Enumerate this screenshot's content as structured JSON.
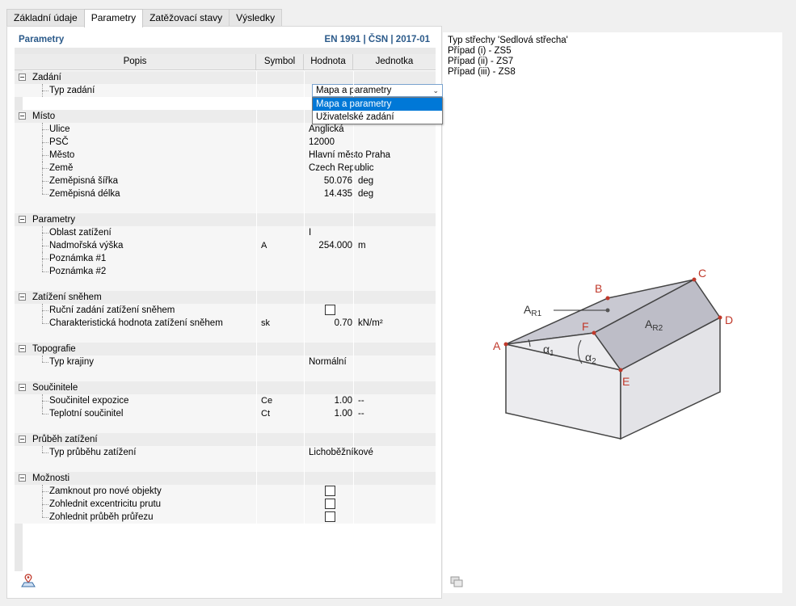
{
  "tabs": [
    {
      "label": "Základní údaje",
      "active": false
    },
    {
      "label": "Parametry",
      "active": true
    },
    {
      "label": "Zatěžovací stavy",
      "active": false
    },
    {
      "label": "Výsledky",
      "active": false
    }
  ],
  "panel": {
    "title": "Parametry",
    "standard": "EN 1991 | ČSN | 2017-01"
  },
  "columns": {
    "popis": "Popis",
    "symbol": "Symbol",
    "hodnota": "Hodnota",
    "jednotka": "Jednotka"
  },
  "groups": {
    "zadani": {
      "label": "Zadání",
      "typ_zadani": {
        "label": "Typ zadání",
        "value": "Mapa a parametry"
      }
    },
    "misto": {
      "label": "Místo",
      "items": [
        {
          "label": "Ulice",
          "value": "Anglická"
        },
        {
          "label": "PSČ",
          "value": "12000"
        },
        {
          "label": "Město",
          "value": "Hlavní město Praha"
        },
        {
          "label": "Země",
          "value": "Czech Republic"
        },
        {
          "label": "Zeměpisná šířka",
          "value": "50.076",
          "unit": "deg"
        },
        {
          "label": "Zeměpisná délka",
          "value": "14.435",
          "unit": "deg"
        }
      ]
    },
    "parametry": {
      "label": "Parametry",
      "items": [
        {
          "label": "Oblast zatížení",
          "value": "I"
        },
        {
          "label": "Nadmořská výška",
          "symbol": "A",
          "value": "254.000",
          "unit": "m"
        },
        {
          "label": "Poznámka #1"
        },
        {
          "label": "Poznámka #2"
        }
      ]
    },
    "snih": {
      "label": "Zatížení sněhem",
      "items": [
        {
          "label": "Ruční zadání zatížení sněhem",
          "checked": false
        },
        {
          "label": "Charakteristická hodnota zatížení sněhem",
          "symbol": "sk",
          "value": "0.70",
          "unit": "kN/m²"
        }
      ]
    },
    "topografie": {
      "label": "Topografie",
      "items": [
        {
          "label": "Typ krajiny",
          "value": "Normální"
        }
      ]
    },
    "soucinitele": {
      "label": "Součinitele",
      "items": [
        {
          "label": "Součinitel expozice",
          "symbol": "Ce",
          "value": "1.00",
          "unit": "--"
        },
        {
          "label": "Teplotní součinitel",
          "symbol": "Ct",
          "value": "1.00",
          "unit": "--"
        }
      ]
    },
    "prubeh": {
      "label": "Průběh zatížení",
      "items": [
        {
          "label": "Typ průběhu zatížení",
          "value": "Lichoběžníkové"
        }
      ]
    },
    "moznosti": {
      "label": "Možnosti",
      "items": [
        {
          "label": "Zamknout pro nové objekty",
          "checked": false
        },
        {
          "label": "Zohlednit excentricitu prutu",
          "checked": false
        },
        {
          "label": "Zohlednit průběh průřezu",
          "checked": false
        }
      ]
    }
  },
  "dropdown": {
    "options": [
      "Mapa a parametry",
      "Uživatelské zadání"
    ],
    "selected": "Mapa a parametry"
  },
  "info": {
    "roof_type": "Typ střechy 'Sedlová střecha'",
    "case1": "Případ (i) - ZS5",
    "case2": "Případ (ii) - ZS7",
    "case3": "Případ (iii) - ZS8"
  },
  "diagram": {
    "points": [
      "A",
      "B",
      "C",
      "D",
      "E",
      "F"
    ],
    "ar1": "A",
    "ar1_sub": "R1",
    "ar2": "A",
    "ar2_sub": "R2",
    "alpha1": "α",
    "alpha1_sub": "1",
    "alpha2": "α",
    "alpha2_sub": "2",
    "accent": "#c0392b"
  }
}
